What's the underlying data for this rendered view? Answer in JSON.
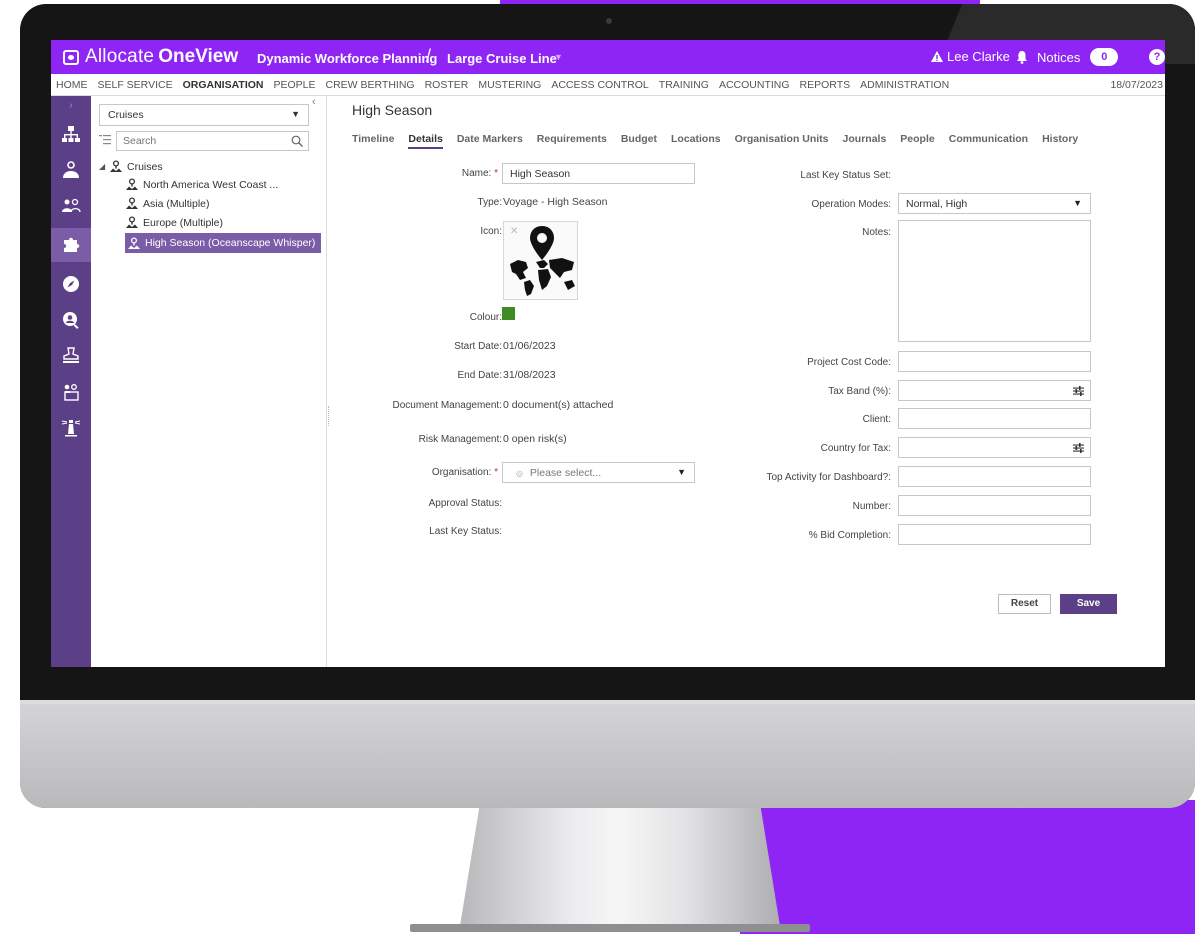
{
  "header": {
    "logo_light": "Allocate",
    "logo_bold": "OneView",
    "module": "Dynamic Workforce Planning",
    "separator": "/",
    "context": "Large Cruise Line",
    "user": "Lee Clarke",
    "notices_label": "Notices",
    "notices_count": "0",
    "help": "?"
  },
  "menu": {
    "items": [
      "HOME",
      "SELF SERVICE",
      "ORGANISATION",
      "PEOPLE",
      "CREW BERTHING",
      "ROSTER",
      "MUSTERING",
      "ACCESS CONTROL",
      "TRAINING",
      "ACCOUNTING",
      "REPORTS",
      "ADMINISTRATION"
    ],
    "active": "ORGANISATION",
    "date": "18/07/2023"
  },
  "rail": {
    "icons": [
      "org-chart-icon",
      "location-people-icon",
      "people-icon",
      "puzzle-icon",
      "compass-icon",
      "search-person-icon",
      "stamp-icon",
      "users-folder-icon",
      "lighthouse-icon"
    ],
    "selected": "puzzle-icon"
  },
  "tree": {
    "selector_value": "Cruises",
    "search_placeholder": "Search",
    "root": "Cruises",
    "children": [
      "North America West Coast ...",
      "Asia (Multiple)",
      "Europe (Multiple)",
      "High Season (Oceanscape Whisper)"
    ],
    "selected_index": 3
  },
  "page": {
    "title": "High Season",
    "tabs": [
      "Timeline",
      "Details",
      "Date Markers",
      "Requirements",
      "Budget",
      "Locations",
      "Organisation Units",
      "Journals",
      "People",
      "Communication",
      "History"
    ],
    "active_tab": "Details"
  },
  "form_left": {
    "name_label": "Name:",
    "name_value": "High Season",
    "type_label": "Type:",
    "type_value": "Voyage - High Season",
    "icon_label": "Icon:",
    "icon_name": "world-map-pin-icon",
    "colour_label": "Colour:",
    "colour_value": "#3f8a26",
    "start_label": "Start Date:",
    "start_value": "01/06/2023",
    "end_label": "End Date:",
    "end_value": "31/08/2023",
    "doc_label": "Document Management:",
    "doc_value": "0 document(s) attached",
    "risk_label": "Risk Management:",
    "risk_value": "0 open risk(s)",
    "org_label": "Organisation:",
    "org_placeholder": "Please select...",
    "approval_label": "Approval Status:",
    "last_status_label": "Last Key Status:"
  },
  "form_right": {
    "last_status_set_label": "Last Key Status Set:",
    "opmodes_label": "Operation Modes:",
    "opmodes_value": "Normal, High",
    "notes_label": "Notes:",
    "cost_label": "Project Cost Code:",
    "tax_label": "Tax Band (%):",
    "client_label": "Client:",
    "country_label": "Country for Tax:",
    "activity_label": "Top Activity for Dashboard?:",
    "number_label": "Number:",
    "bid_label": "% Bid Completion:"
  },
  "actions": {
    "reset": "Reset",
    "save": "Save"
  },
  "colors": {
    "brand": "#8e25f5",
    "rail": "#5b3f87",
    "rail_selected": "#7b5ca7"
  }
}
